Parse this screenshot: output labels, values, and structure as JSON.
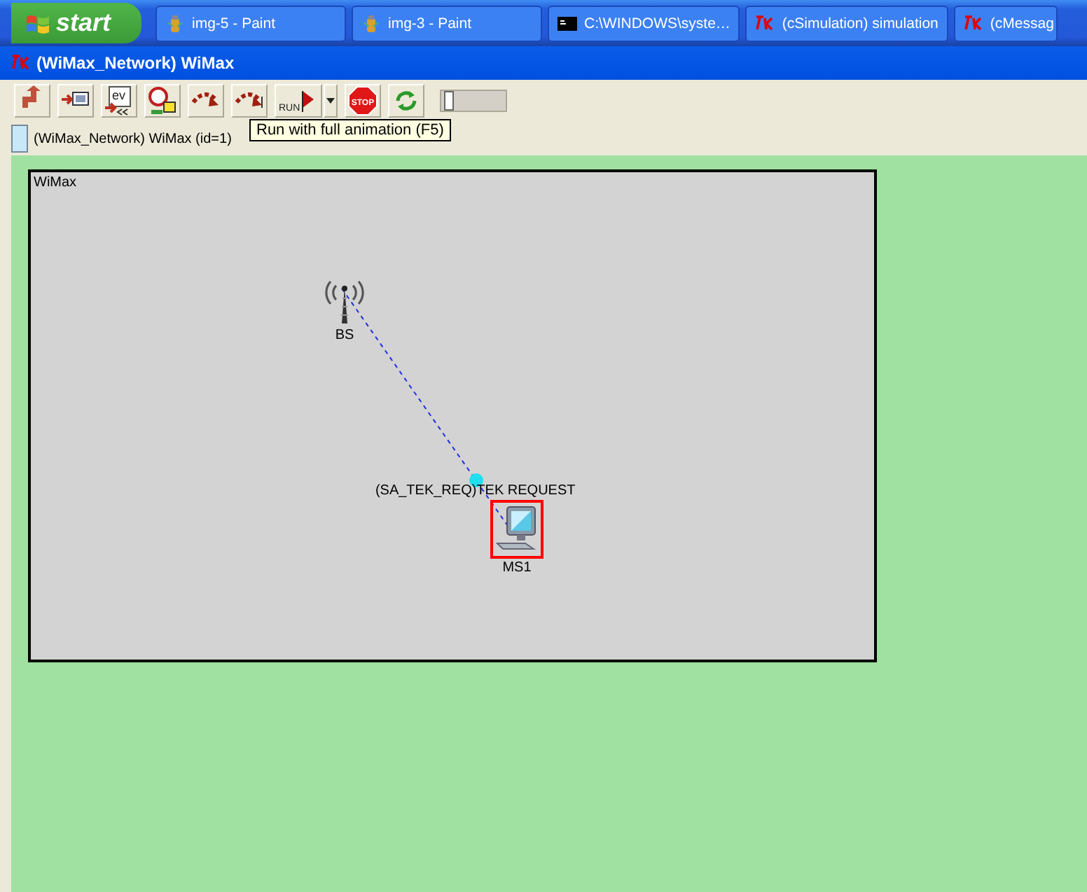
{
  "taskbar": {
    "start": "start",
    "tasks": [
      {
        "label": "img-5 - Paint",
        "kind": "paint",
        "selected": false
      },
      {
        "label": "img-3 - Paint",
        "kind": "paint",
        "selected": false
      },
      {
        "label": "C:\\WINDOWS\\syste…",
        "kind": "console",
        "selected": false
      },
      {
        "label": "(cSimulation) simulation",
        "kind": "tk",
        "selected": false
      },
      {
        "label": "(cMessag",
        "kind": "tk",
        "selected": false
      }
    ]
  },
  "window": {
    "title": "(WiMax_Network) WiMax"
  },
  "toolbar": {
    "buttons": [
      {
        "kind": "up"
      },
      {
        "kind": "module"
      },
      {
        "kind": "events",
        "text": "ev"
      },
      {
        "kind": "find"
      },
      {
        "kind": "step"
      },
      {
        "kind": "step-out"
      },
      {
        "kind": "run",
        "text": "RUN"
      },
      {
        "kind": "dropdown"
      },
      {
        "kind": "stop",
        "text": "STOP"
      },
      {
        "kind": "refresh"
      }
    ],
    "speed": {
      "level": 0.05
    },
    "tooltip": "Run with full animation (F5)"
  },
  "breadcrumb": "(WiMax_Network) WiMax  (id=1)",
  "network": {
    "title": "WiMax",
    "nodes": [
      {
        "label": "BS",
        "kind": "antenna",
        "selected": false
      },
      {
        "label": "MS1",
        "kind": "computer",
        "selected": true
      }
    ],
    "message": {
      "label": "(SA_TEK_REQ)TEK REQUEST"
    }
  }
}
